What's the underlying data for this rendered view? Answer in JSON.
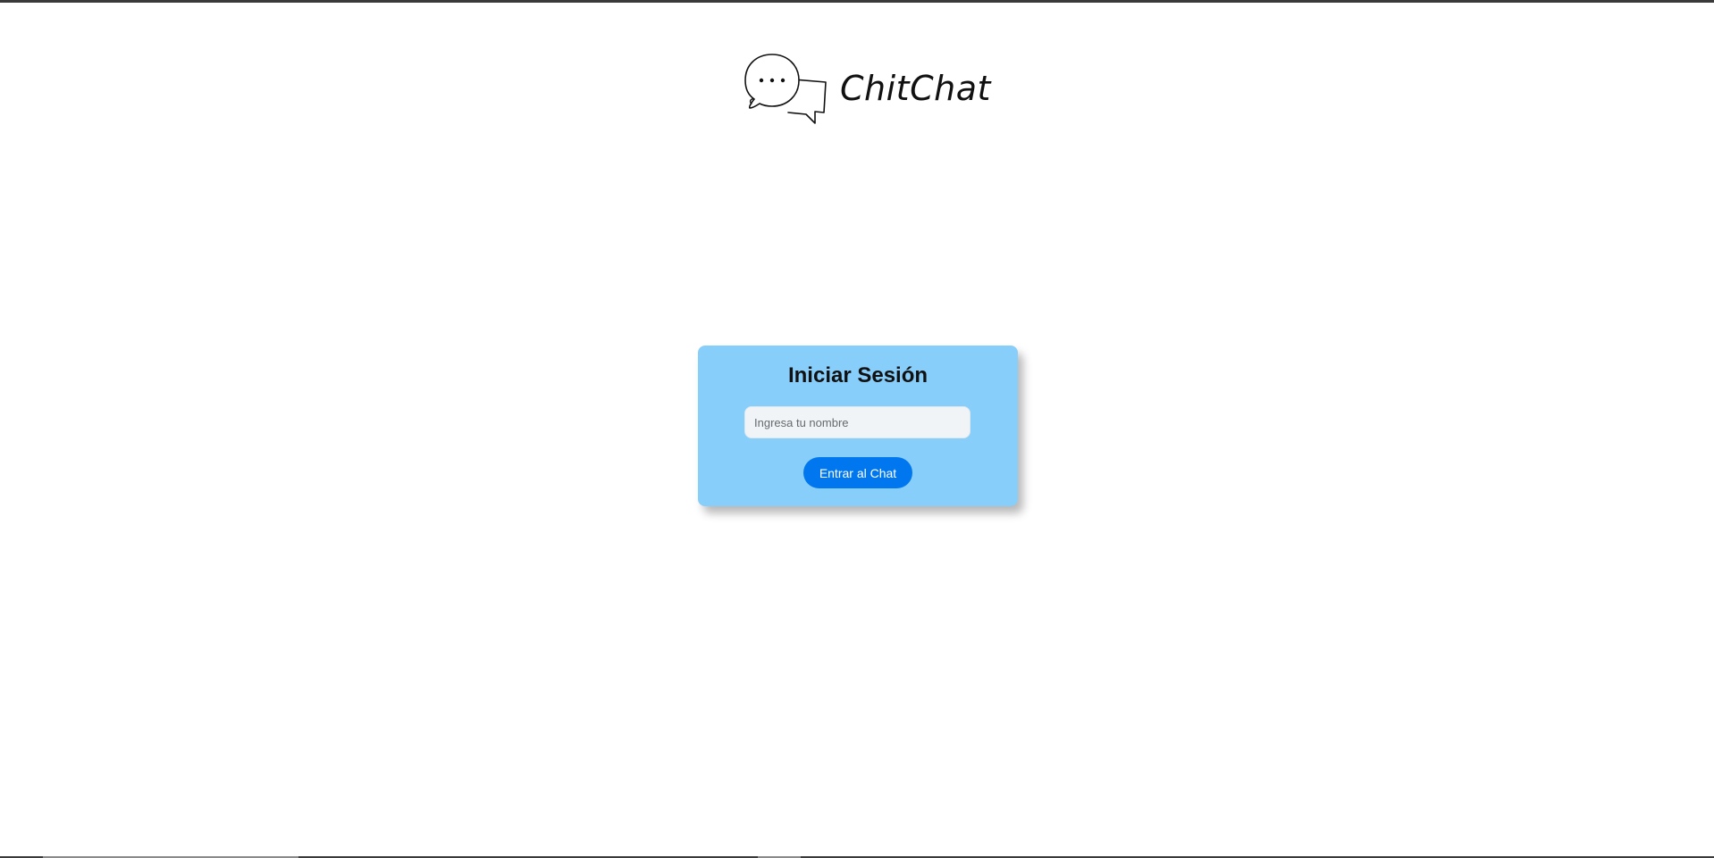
{
  "app": {
    "name": "ChitChat",
    "logo_icon": "chat-bubbles-icon"
  },
  "login": {
    "title": "Iniciar Sesión",
    "name_placeholder": "Ingresa tu nombre",
    "name_value": "",
    "submit_label": "Entrar al Chat"
  },
  "colors": {
    "card_background": "#87cefa",
    "button_background": "#0077ee",
    "input_background": "#f0f4f7"
  }
}
